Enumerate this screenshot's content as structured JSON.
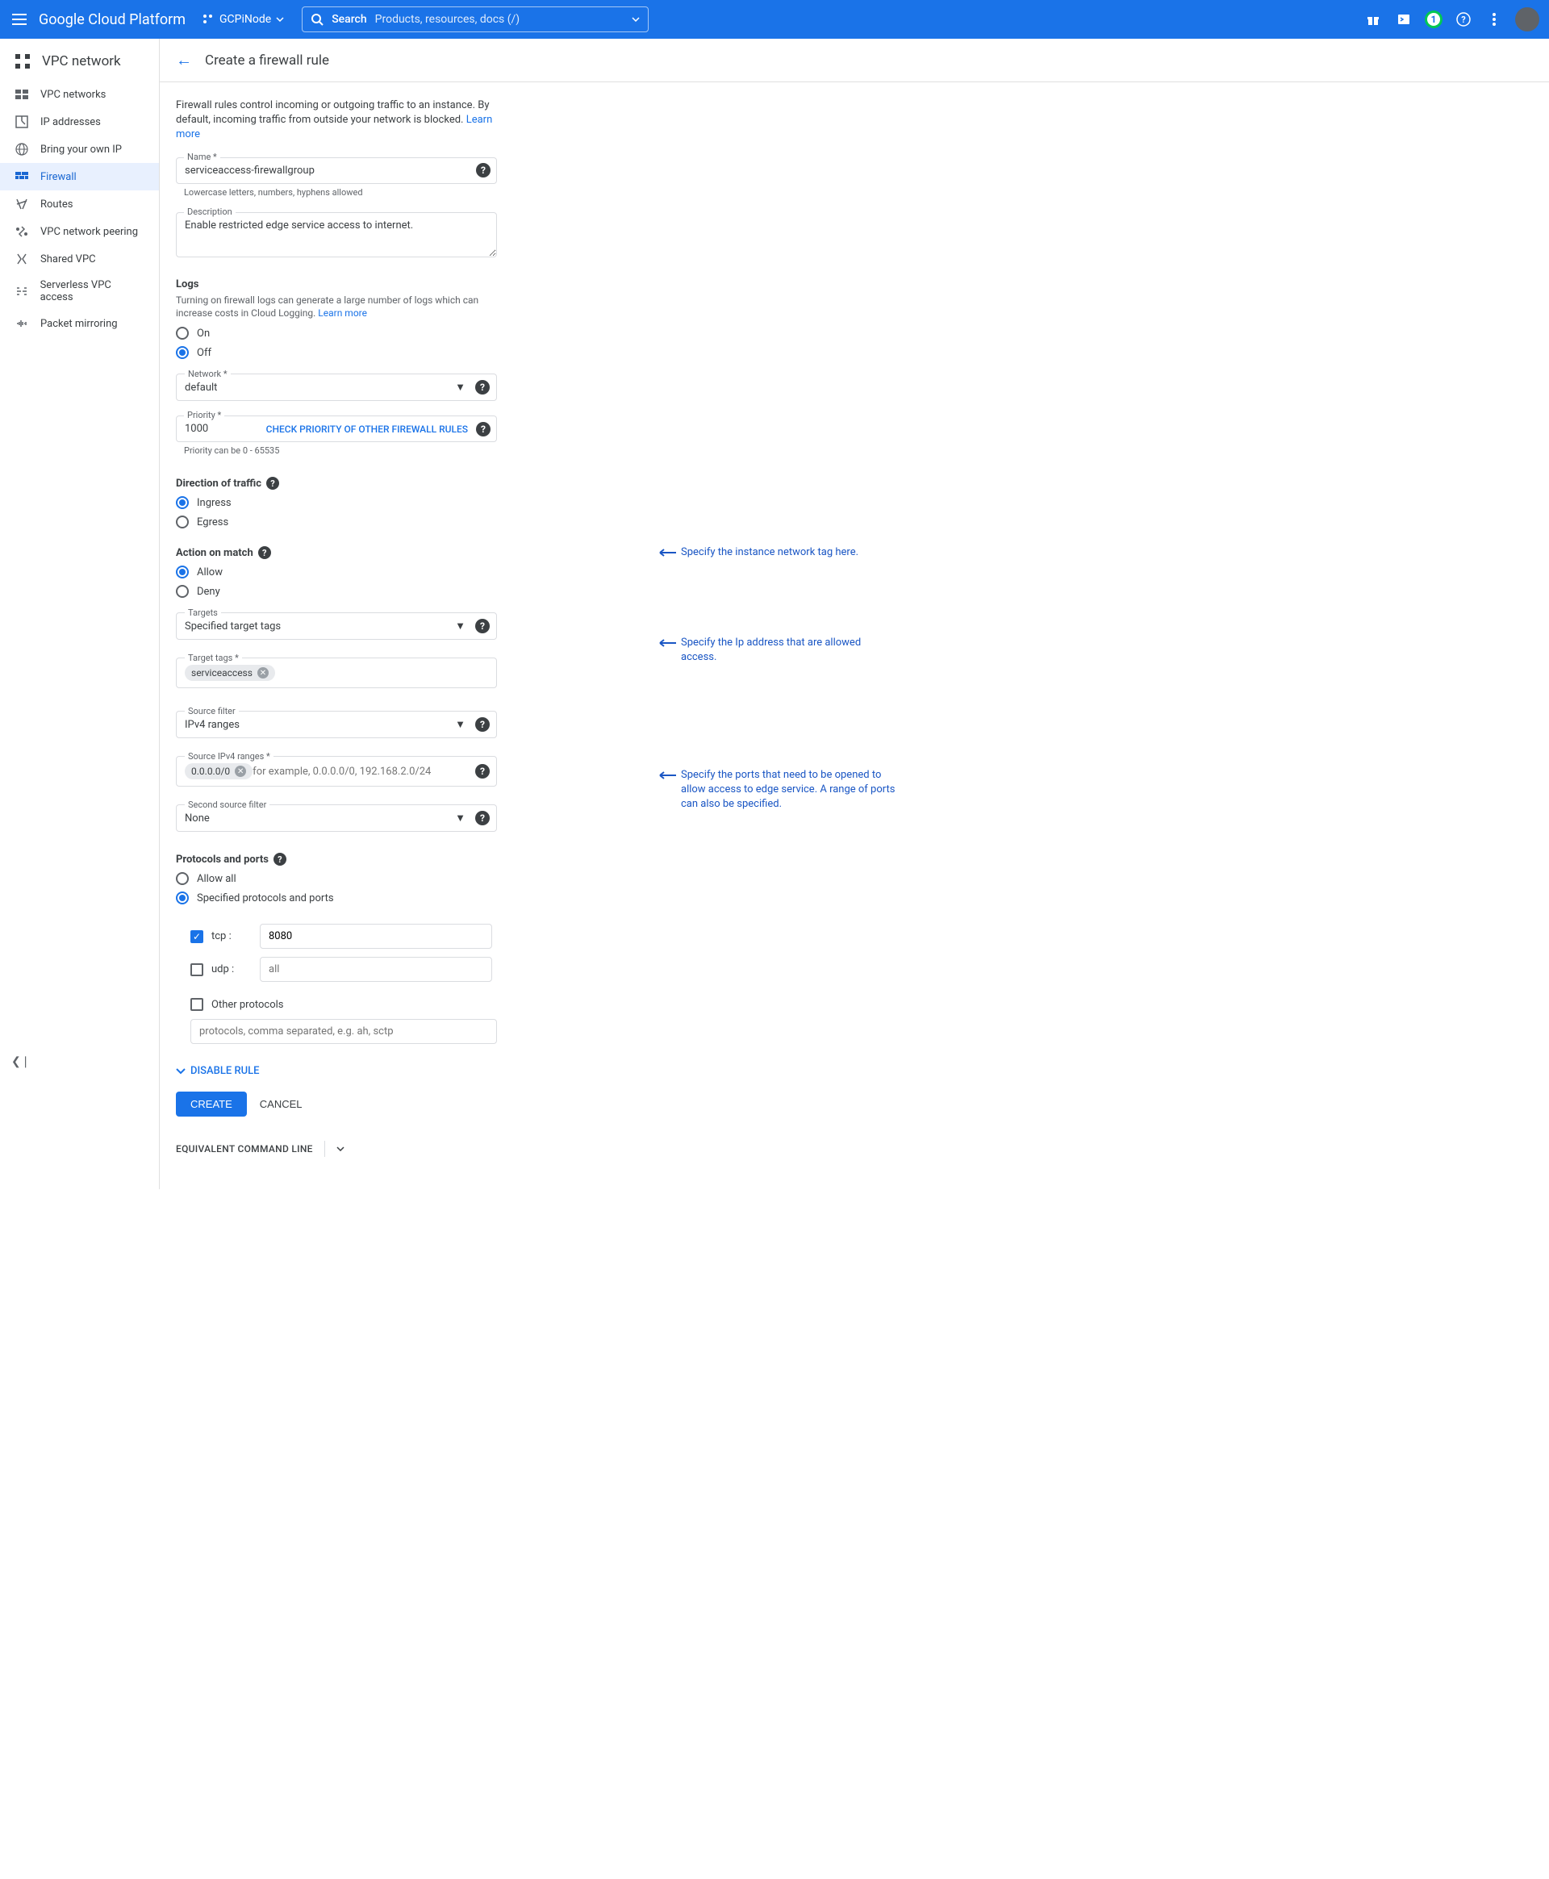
{
  "header": {
    "brand": "Google Cloud Platform",
    "project": "GCPiNode",
    "search_label": "Search",
    "search_placeholder": "Products, resources, docs (/)",
    "notif_count": "1"
  },
  "sidebar": {
    "title": "VPC network",
    "items": [
      {
        "label": "VPC networks"
      },
      {
        "label": "IP addresses"
      },
      {
        "label": "Bring your own IP"
      },
      {
        "label": "Firewall"
      },
      {
        "label": "Routes"
      },
      {
        "label": "VPC network peering"
      },
      {
        "label": "Shared VPC"
      },
      {
        "label": "Serverless VPC access"
      },
      {
        "label": "Packet mirroring"
      }
    ]
  },
  "page": {
    "title": "Create a firewall rule",
    "intro": "Firewall rules control incoming or outgoing traffic to an instance. By default, incoming traffic from outside your network is blocked. ",
    "learn_more": "Learn more"
  },
  "form": {
    "name_label": "Name *",
    "name_value": "serviceaccess-firewallgroup",
    "name_hint": "Lowercase letters, numbers, hyphens allowed",
    "desc_label": "Description",
    "desc_value": "Enable restricted edge service access to internet.",
    "logs_head": "Logs",
    "logs_text": "Turning on firewall logs can generate a large number of logs which can increase costs in Cloud Logging. ",
    "logs_on": "On",
    "logs_off": "Off",
    "network_label": "Network *",
    "network_value": "default",
    "priority_label": "Priority *",
    "priority_value": "1000",
    "priority_link": "CHECK PRIORITY OF OTHER FIREWALL RULES",
    "priority_hint": "Priority can be 0 - 65535",
    "direction_head": "Direction of traffic",
    "ingress": "Ingress",
    "egress": "Egress",
    "action_head": "Action on match",
    "allow": "Allow",
    "deny": "Deny",
    "targets_label": "Targets",
    "targets_value": "Specified target tags",
    "target_tags_label": "Target tags *",
    "target_tag_chip": "serviceaccess",
    "source_filter_label": "Source filter",
    "source_filter_value": "IPv4 ranges",
    "source_ranges_label": "Source IPv4 ranges *",
    "source_ranges_chip": "0.0.0.0/0",
    "source_ranges_ph": "for example, 0.0.0.0/0, 192.168.2.0/24",
    "second_filter_label": "Second source filter",
    "second_filter_value": "None",
    "proto_head": "Protocols and ports",
    "allow_all": "Allow all",
    "spec_proto": "Specified protocols and ports",
    "tcp_label": "tcp :",
    "tcp_value": "8080",
    "udp_label": "udp :",
    "udp_ph": "all",
    "other_proto": "Other protocols",
    "other_proto_ph": "protocols, comma separated, e.g. ah, sctp",
    "disable_link": "DISABLE RULE",
    "create_btn": "CREATE",
    "cancel_btn": "CANCEL",
    "equiv": "EQUIVALENT COMMAND LINE"
  },
  "annotations": {
    "tags": "Specify the instance network tag here.",
    "ips": "Specify the Ip address that are allowed access.",
    "ports": "Specify the ports that need to be opened to allow access to edge service. A range of ports can also be specified."
  }
}
